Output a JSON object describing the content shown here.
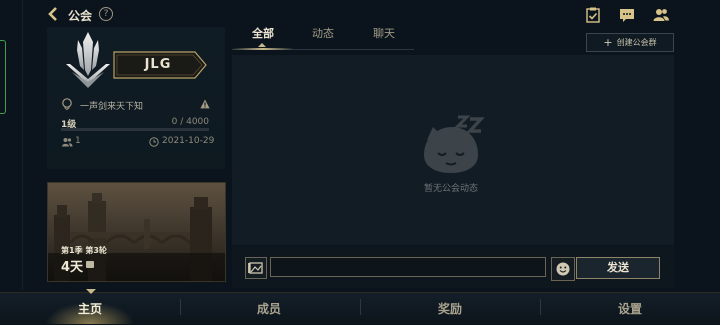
{
  "header": {
    "title": "公会",
    "help_label": "?"
  },
  "guild": {
    "name": "JLG",
    "motto": "一声剑来天下知",
    "level": "1级",
    "exp": "0 / 4000",
    "exp_progress": 0,
    "member_count": "1",
    "created_date": "2021-10-29"
  },
  "season": {
    "label": "第1季 第3轮",
    "days": "4天"
  },
  "tabs": [
    {
      "label": "全部",
      "active": true
    },
    {
      "label": "动态",
      "active": false
    },
    {
      "label": "聊天",
      "active": false
    }
  ],
  "create_group_button": {
    "label": "创建公会群"
  },
  "empty_state": {
    "text": "暂无公会动态"
  },
  "chat": {
    "input_value": "",
    "send_label": "发送"
  },
  "bottom_nav": [
    {
      "label": "主页",
      "active": true
    },
    {
      "label": "成员",
      "active": false
    },
    {
      "label": "奖励",
      "active": false
    },
    {
      "label": "设置",
      "active": false
    }
  ],
  "colors": {
    "background": "#0b141c",
    "panel": "#121c25",
    "gold_accent": "#c8b98c",
    "edge_tab_green": "#3da24a"
  }
}
